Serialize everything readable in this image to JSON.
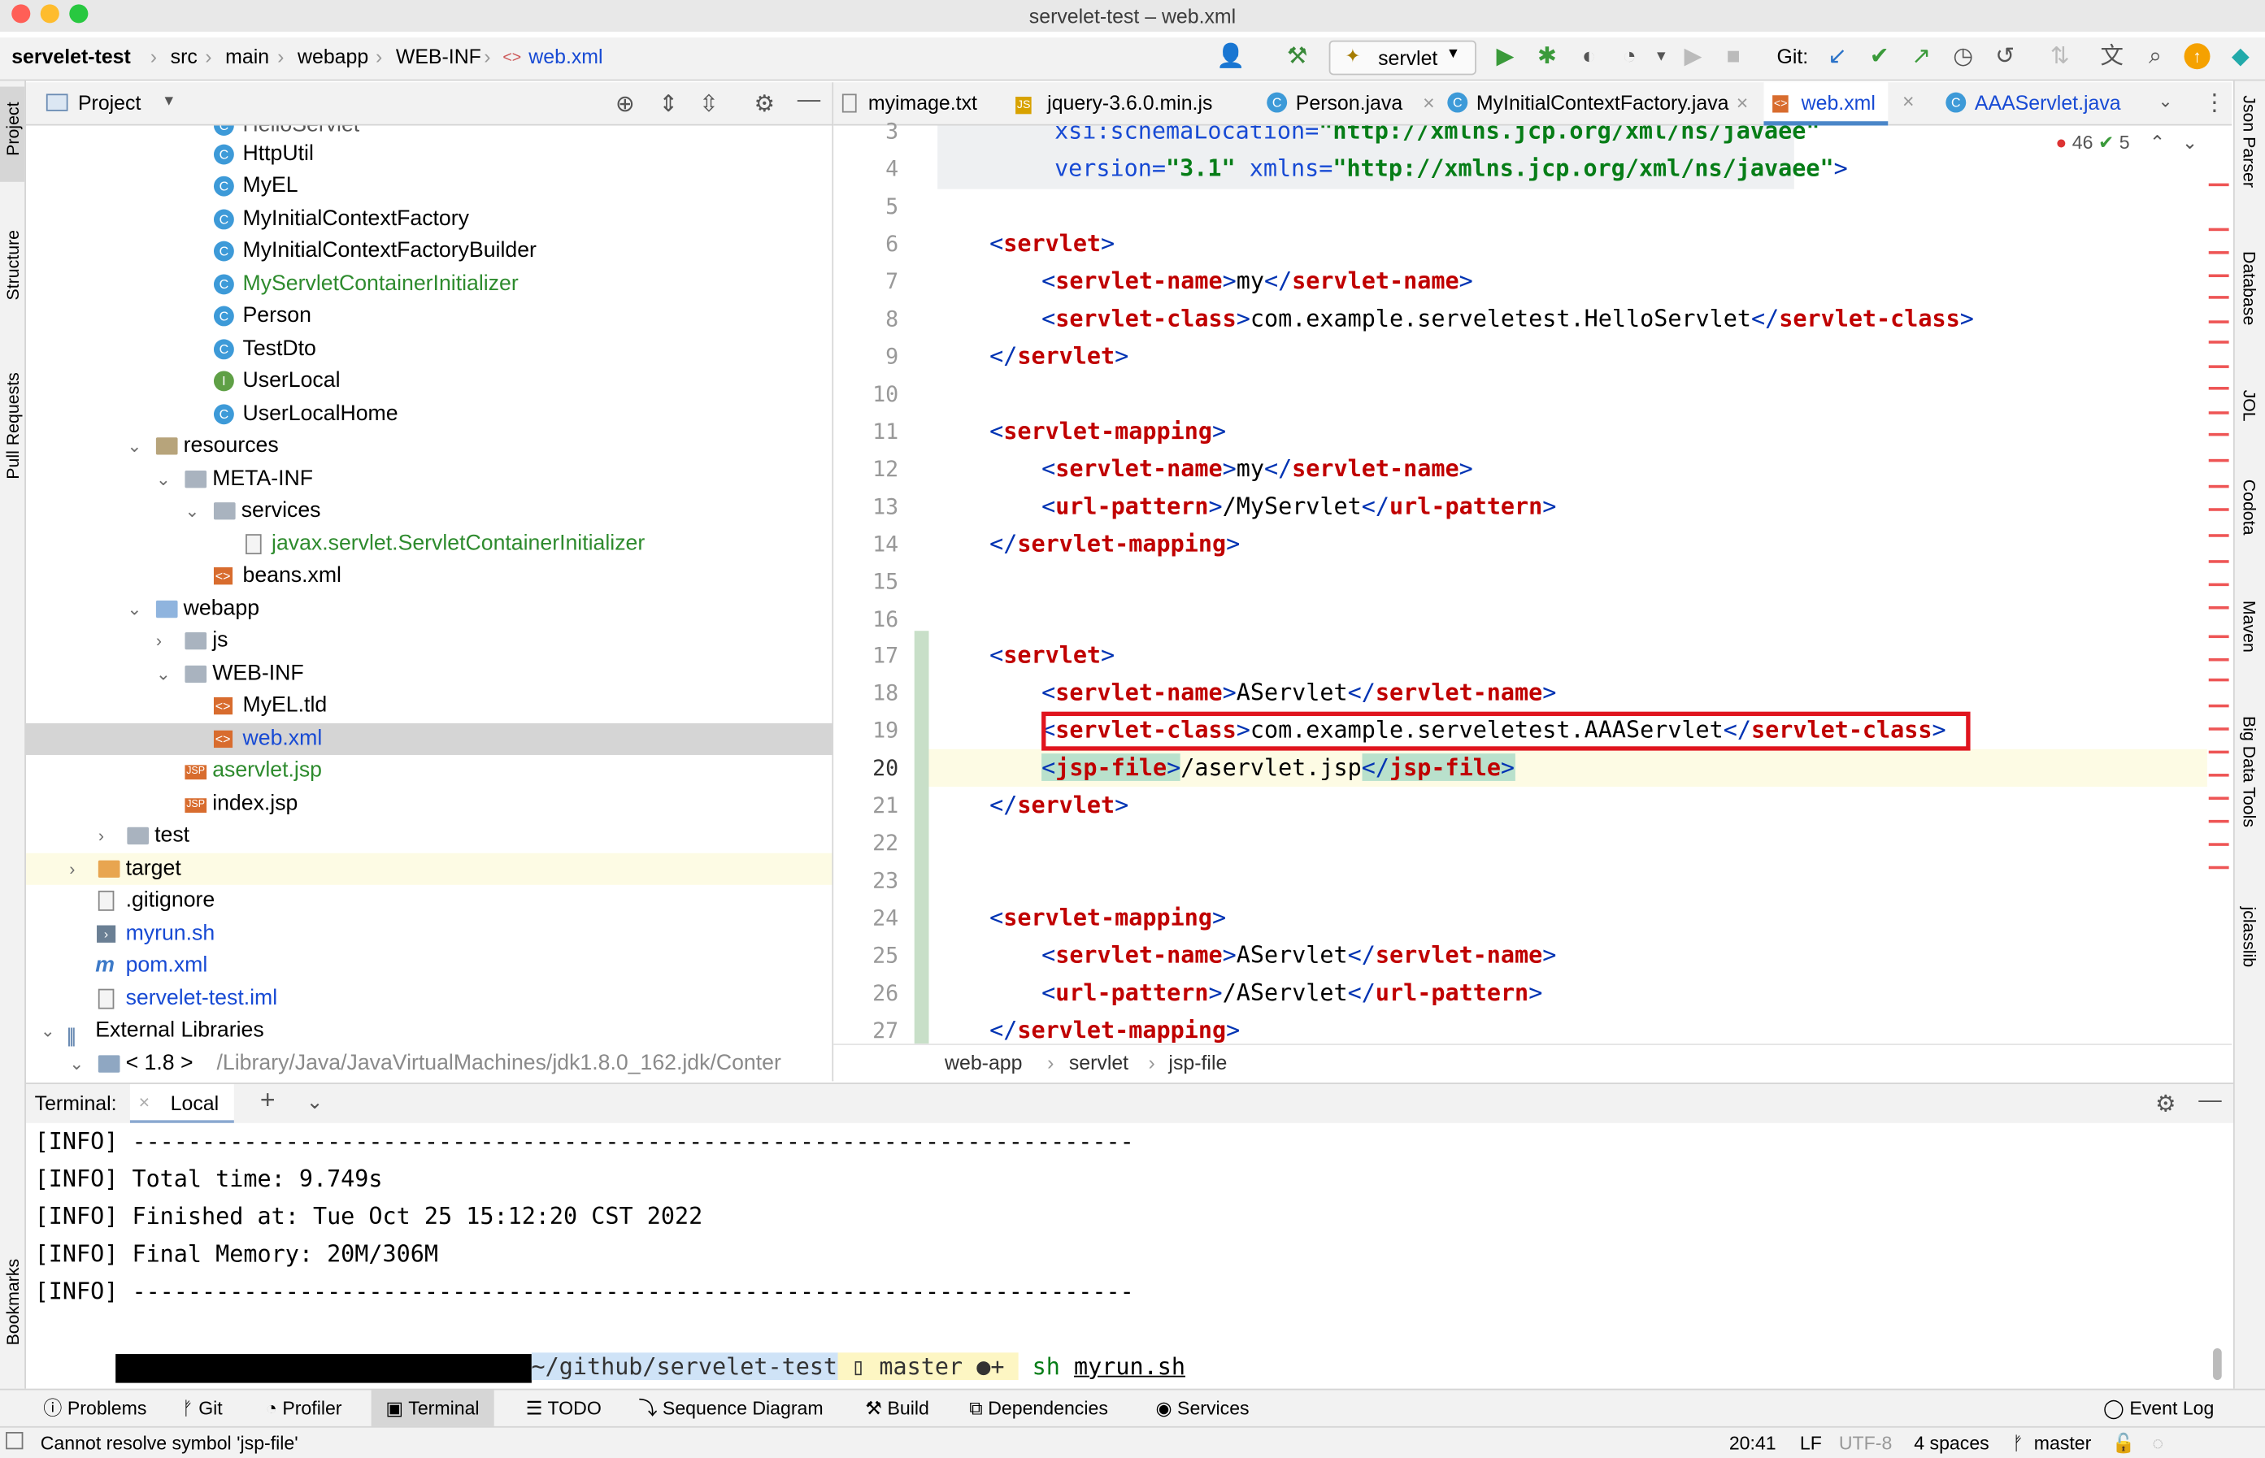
{
  "window": {
    "title": "servelet-test – web.xml"
  },
  "navbar": {
    "crumbs": [
      "servelet-test",
      "src",
      "main",
      "webapp",
      "WEB-INF",
      "web.xml"
    ],
    "run_config": "servlet",
    "git_label": "Git:"
  },
  "left_stripe": {
    "project": "Project",
    "structure": "Structure",
    "pull_requests": "Pull Requests",
    "bookmarks": "Bookmarks"
  },
  "right_stripe": {
    "json_parser": "Json Parser",
    "database": "Database",
    "jol": "JOL",
    "codota": "Codota",
    "maven": "Maven",
    "big_data": "Big Data Tools",
    "jclasslib": "jclasslib"
  },
  "project_panel": {
    "title": "Project",
    "tree": [
      {
        "label": "HttpUtil",
        "kind": "class"
      },
      {
        "label": "MyEL",
        "kind": "class"
      },
      {
        "label": "MyInitialContextFactory",
        "kind": "class"
      },
      {
        "label": "MyInitialContextFactoryBuilder",
        "kind": "class"
      },
      {
        "label": "MyServletContainerInitializer",
        "kind": "class"
      },
      {
        "label": "Person",
        "kind": "class"
      },
      {
        "label": "TestDto",
        "kind": "class"
      },
      {
        "label": "UserLocal",
        "kind": "interface"
      },
      {
        "label": "UserLocalHome",
        "kind": "class"
      },
      {
        "label": "resources",
        "kind": "folder"
      },
      {
        "label": "META-INF",
        "kind": "folder"
      },
      {
        "label": "services",
        "kind": "folder"
      },
      {
        "label": "javax.servlet.ServletContainerInitializer",
        "kind": "file"
      },
      {
        "label": "beans.xml",
        "kind": "xml"
      },
      {
        "label": "webapp",
        "kind": "folder"
      },
      {
        "label": "js",
        "kind": "folder"
      },
      {
        "label": "WEB-INF",
        "kind": "folder"
      },
      {
        "label": "MyEL.tld",
        "kind": "xml"
      },
      {
        "label": "web.xml",
        "kind": "xml"
      },
      {
        "label": "aservlet.jsp",
        "kind": "jsp"
      },
      {
        "label": "index.jsp",
        "kind": "jsp"
      },
      {
        "label": "test",
        "kind": "folder"
      },
      {
        "label": "target",
        "kind": "folder"
      },
      {
        "label": ".gitignore",
        "kind": "file"
      },
      {
        "label": "myrun.sh",
        "kind": "file"
      },
      {
        "label": "pom.xml",
        "kind": "file"
      },
      {
        "label": "servelet-test.iml",
        "kind": "file"
      },
      {
        "label": "External Libraries",
        "kind": "lib"
      },
      {
        "label": "< 1.8 >",
        "kind": "lib"
      }
    ],
    "jdk_path": "/Library/Java/JavaVirtualMachines/jdk1.8.0_162.jdk/Conter"
  },
  "tabs": [
    "myimage.txt",
    "jquery-3.6.0.min.js",
    "Person.java",
    "MyInitialContextFactory.java",
    "web.xml",
    "AAAServlet.java"
  ],
  "inspections": {
    "errors": "46",
    "warnings": "5"
  },
  "editor": {
    "line_numbers": [
      "3",
      "4",
      "5",
      "6",
      "7",
      "8",
      "9",
      "10",
      "11",
      "12",
      "13",
      "14",
      "15",
      "16",
      "17",
      "18",
      "19",
      "20",
      "21",
      "22",
      "23",
      "24",
      "25",
      "26",
      "27"
    ],
    "l3_attr": "xsi:schemaLocation=",
    "l3_val": "\"http://xmlns.jcp.org/xml/ns/javaee\"",
    "l4_attr1": "version=",
    "l4_val1": "\"3.1\"",
    "l4_attr2": "xmlns=",
    "l4_val2": "\"http://xmlns.jcp.org/xml/ns/javaee\"",
    "servlet": "servlet",
    "servlet_name": "servlet-name",
    "servlet_class": "servlet-class",
    "servlet_mapping": "servlet-mapping",
    "url_pattern": "url-pattern",
    "jsp_file": "jsp-file",
    "v_my": "my",
    "v_hello": "com.example.serveletest.HelloServlet",
    "v_myservlet": "/MyServlet",
    "v_aservlet": "AServlet",
    "v_aaa": "com.example.serveletest.AAAServlet",
    "v_jsp": "/aservlet.jsp",
    "v_aservlet_url": "/AServlet"
  },
  "editor_breadcrumb": [
    "web-app",
    "servlet",
    "jsp-file"
  ],
  "terminal": {
    "label": "Terminal:",
    "tab": "Local",
    "lines": [
      "[INFO] ------------------------------------------------------------------------",
      "[INFO] Total time: 9.749s",
      "[INFO] Finished at: Tue Oct 25 15:12:20 CST 2022",
      "[INFO] Final Memory: 20M/306M",
      "[INFO] ------------------------------------------------------------------------"
    ],
    "prompt_path": "~/github/servelet-test",
    "prompt_branch": "master",
    "cmd1": "sh",
    "cmd1_arg": "myrun.sh"
  },
  "toolwindows": [
    "Problems",
    "Git",
    "Profiler",
    "Terminal",
    "TODO",
    "Sequence Diagram",
    "Build",
    "Dependencies",
    "Services"
  ],
  "event_log": "Event Log",
  "status": {
    "message": "Cannot resolve symbol 'jsp-file'",
    "position": "20:41",
    "line_sep": "LF",
    "encoding": "UTF-8",
    "indent": "4 spaces",
    "branch": "master"
  },
  "colors": {
    "tag": "#c00000",
    "attr": "#174ad4",
    "string": "#067d17",
    "highlight_box": "#e0141e"
  }
}
